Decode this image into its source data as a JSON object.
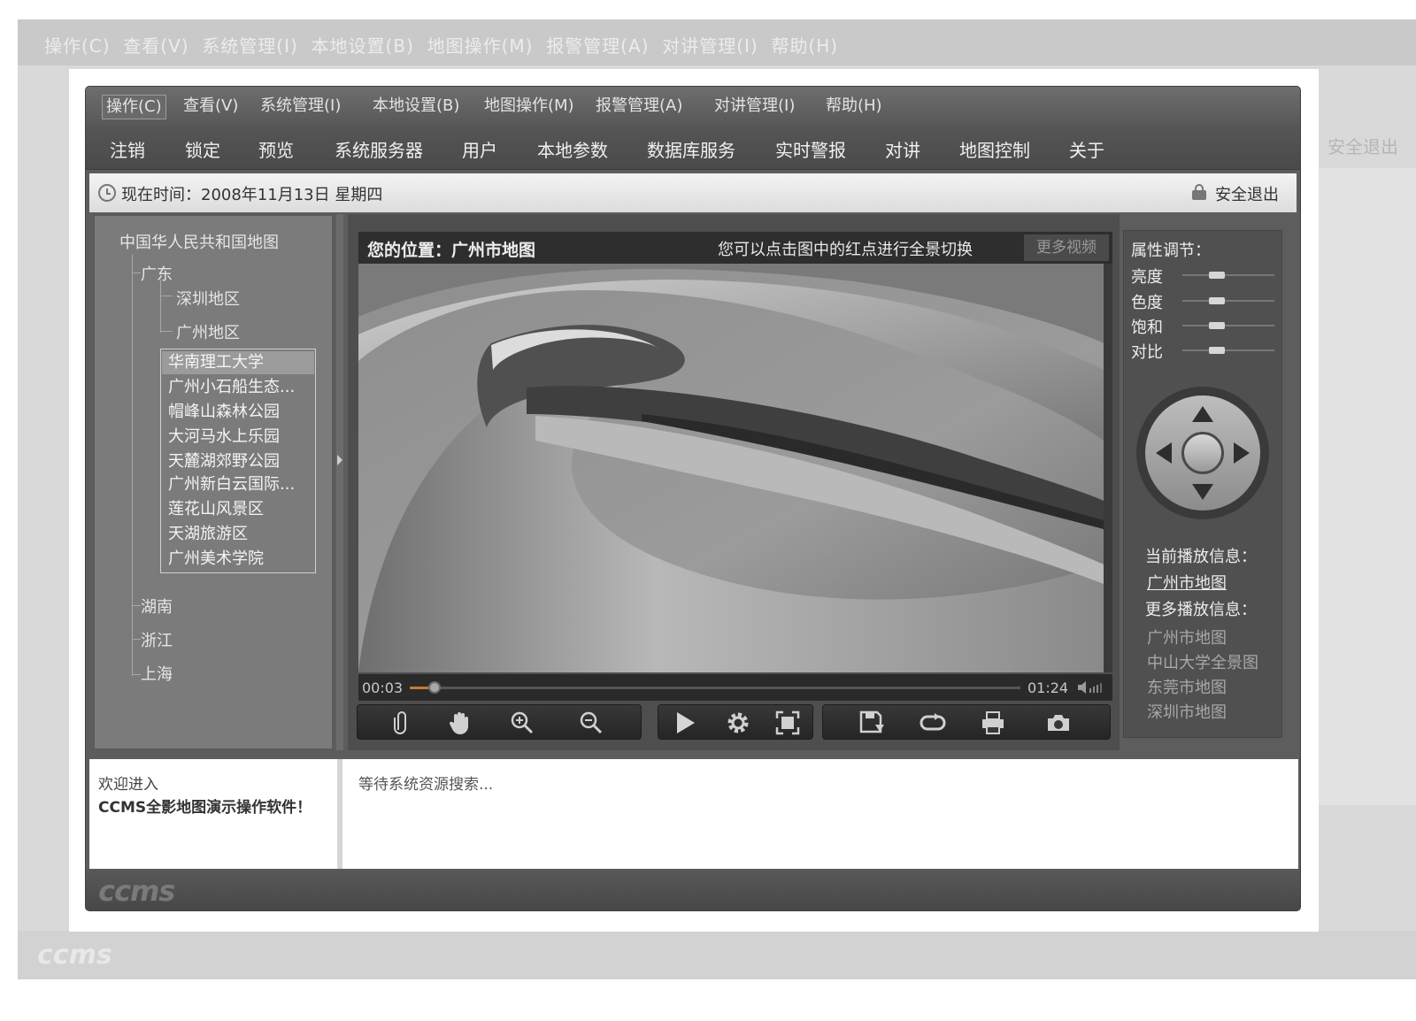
{
  "menu": [
    "操作(C)",
    "查看(V)",
    "系统管理(I)",
    "本地设置(B)",
    "地图操作(M)",
    "报警管理(A)",
    "对讲管理(I)",
    "帮助(H)"
  ],
  "toolbar": [
    "注销",
    "锁定",
    "预览",
    "系统服务器",
    "用户",
    "本地参数",
    "数据库服务",
    "实时警报",
    "对讲",
    "地图控制",
    "关于"
  ],
  "status": {
    "time_text": "现在时间：2008年11月13日 星期四",
    "logout": "安全退出"
  },
  "tree": {
    "root": "中国华人民共和国地图",
    "province1": "广东",
    "region1": "深圳地区",
    "region2": "广州地区",
    "leaves": [
      "华南理工大学",
      "广州小石船生态...",
      "帽峰山森林公园",
      "大河马水上乐园",
      "天麓湖郊野公园",
      "广州新白云国际...",
      "莲花山风景区",
      "天湖旅游区",
      "广州美术学院"
    ],
    "province2": "湖南",
    "province3": "浙江",
    "province4": "上海"
  },
  "video": {
    "location": "您的位置：广州市地图",
    "hint": "您可以点击图中的红点进行全景切换",
    "more_button": "更多视频",
    "current_time": "00:03",
    "total_time": "01:24",
    "progress": 0.04
  },
  "properties": {
    "title": "属性调节：",
    "rows": [
      {
        "label": "亮度",
        "value": 0.35
      },
      {
        "label": "色度",
        "value": 0.35
      },
      {
        "label": "饱和",
        "value": 0.35
      },
      {
        "label": "对比",
        "value": 0.35
      }
    ]
  },
  "playback": {
    "current_label": "当前播放信息：",
    "current": "广州市地图",
    "more_label": "更多播放信息：",
    "more": [
      "广州市地图",
      "中山大学全景图",
      "东莞市地图",
      "深圳市地图"
    ]
  },
  "bottom": {
    "welcome_line1": "欢迎进入",
    "welcome_line2": "CCMS全影地图演示操作软件！",
    "search_status": "等待系统资源搜索..."
  },
  "footer": {
    "logo": "ccms"
  },
  "colors": {
    "window": "#5d5d5d",
    "accent": "#c77a2a"
  }
}
